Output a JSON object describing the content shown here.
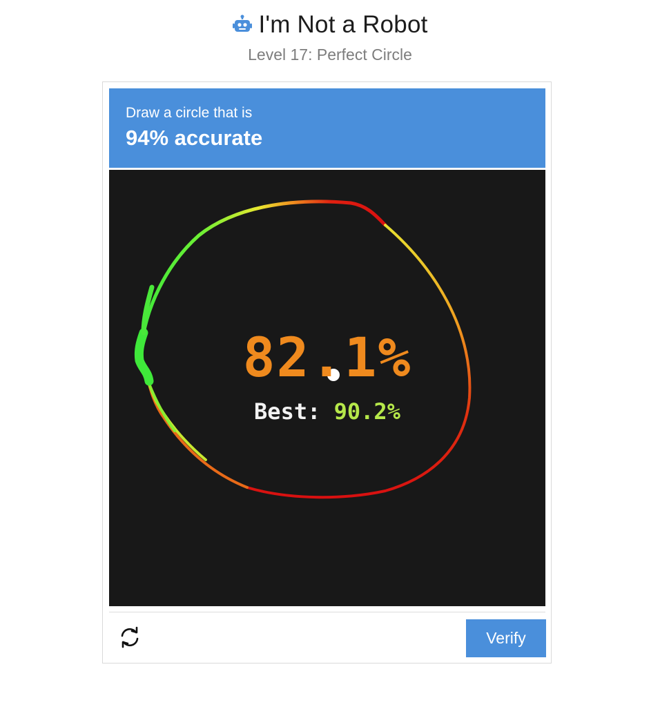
{
  "header": {
    "title": "I'm Not a Robot",
    "subtitle": "Level 17: Perfect Circle",
    "icon": "robot-icon"
  },
  "challenge": {
    "prompt_line1": "Draw a circle that is",
    "prompt_line2": "94% accurate",
    "banner_color": "#4a8fdb"
  },
  "canvas": {
    "background": "#181818",
    "score": "82.1%",
    "score_color": "#ef8a1e",
    "best_label": "Best:",
    "best_value": "90.2%",
    "best_color": "#b6e84a"
  },
  "footer": {
    "refresh_icon": "refresh-icon",
    "verify_label": "Verify"
  }
}
